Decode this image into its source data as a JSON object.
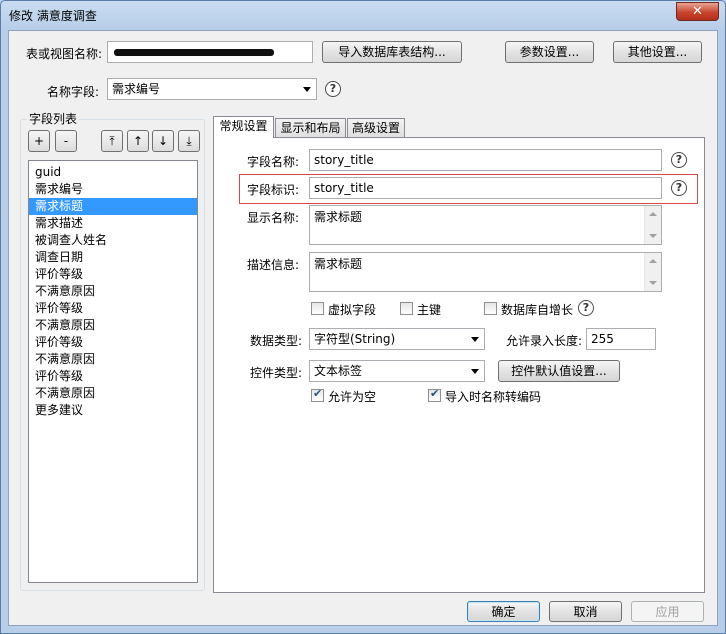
{
  "window": {
    "title": "修改 满意度调查",
    "close_glyph": "✕"
  },
  "top": {
    "table_label": "表或视图名称:",
    "table_value": "",
    "import_btn": "导入数据库表结构...",
    "params_btn": "参数设置...",
    "other_btn": "其他设置...",
    "name_field_label": "名称字段:",
    "name_field_value": "需求编号",
    "help_glyph": "?"
  },
  "field_list": {
    "title": "字段列表",
    "add_btn": "+",
    "remove_btn": "-",
    "move_top_btn": "⤒",
    "move_up_btn": "↑",
    "move_down_btn": "↓",
    "move_bottom_btn": "⤓",
    "items": [
      "guid",
      "需求编号",
      "需求标题",
      "需求描述",
      "被调查人姓名",
      "调查日期",
      "评价等级",
      "不满意原因",
      "评价等级",
      "不满意原因",
      "评价等级",
      "不满意原因",
      "评价等级",
      "不满意原因",
      "更多建议"
    ],
    "selected_index": 2
  },
  "tabs": [
    "常规设置",
    "显示和布局",
    "高级设置"
  ],
  "general": {
    "field_name_label": "字段名称:",
    "field_name_value": "story_title",
    "field_id_label": "字段标识:",
    "field_id_value": "story_title",
    "display_name_label": "显示名称:",
    "display_name_value": "需求标题",
    "desc_label": "描述信息:",
    "desc_value": "需求标题",
    "virtual_label": "虚拟字段",
    "pk_label": "主键",
    "autoinc_label": "数据库自增长",
    "data_type_label": "数据类型:",
    "data_type_value": "字符型(String)",
    "max_len_label": "允许录入长度:",
    "max_len_value": "255",
    "control_type_label": "控件类型:",
    "control_type_value": "文本标签",
    "control_default_btn": "控件默认值设置...",
    "allow_null_label": "允许为空",
    "encode_label": "导入时名称转编码"
  },
  "footer": {
    "ok": "确定",
    "cancel": "取消",
    "apply": "应用"
  },
  "colors": {
    "selection": "#3399ff",
    "highlight_box": "#d9474d",
    "close_button": "#c7452f"
  }
}
